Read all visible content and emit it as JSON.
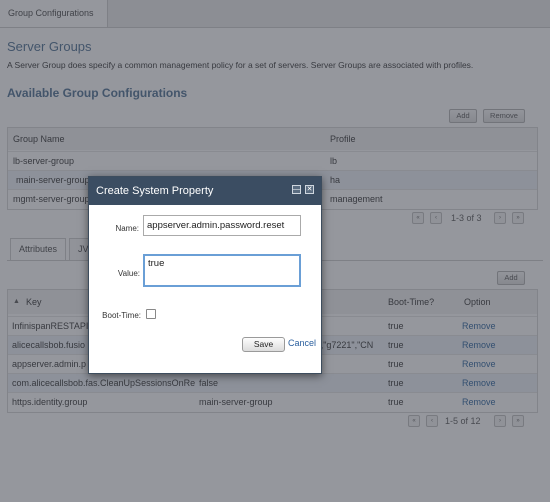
{
  "tabs": {
    "active": "Group Configurations"
  },
  "server_groups": {
    "title": "Server Groups",
    "description": "A Server Group does specify a common management policy for a set of servers. Server Groups are associated with profiles.",
    "available_title": "Available Group Configurations",
    "add_label": "Add",
    "remove_label": "Remove",
    "columns": [
      "Group Name",
      "Profile"
    ],
    "rows": [
      {
        "name": "lb-server-group",
        "profile": "lb"
      },
      {
        "name": "main-server-group",
        "profile": "ha"
      },
      {
        "name": "mgmt-server-group",
        "profile": "management"
      }
    ],
    "pager_text": "1-3 of 3"
  },
  "sub_tabs": [
    "Attributes",
    "JVM"
  ],
  "properties": {
    "add_label": "Add",
    "columns": {
      "key": "Key",
      "boot_time": "Boot-Time?",
      "option": "Option"
    },
    "rows": [
      {
        "key": "InfinispanRESTAPI",
        "value": "",
        "boot": "true",
        "option": "Remove"
      },
      {
        "key": "alicecallsbob.fusio",
        "value": "c\",\"g7221\",\"CN",
        "boot": "true",
        "option": "Remove"
      },
      {
        "key": "appserver.admin.p",
        "value": "",
        "boot": "true",
        "option": "Remove"
      },
      {
        "key": "com.alicecallsbob.fas.CleanUpSessionsOnRe",
        "value": "false",
        "boot": "true",
        "option": "Remove"
      },
      {
        "key": "https.identity.group",
        "value": "main-server-group",
        "boot": "true",
        "option": "Remove"
      }
    ],
    "pager_text": "1-5 of 12"
  },
  "dialog": {
    "title": "Create System Property",
    "name_label": "Name:",
    "name_value": "appserver.admin.password.reset",
    "value_label": "Value:",
    "value_value": "true",
    "boot_label": "Boot-Time:",
    "boot_checked": false,
    "save_label": "Save",
    "cancel_label": "Cancel"
  },
  "icons": {
    "maximize": "maximize-icon",
    "close": "close-icon",
    "sort": "sort-asc-icon",
    "pager_first": "first-page-icon",
    "pager_prev": "prev-page-icon",
    "pager_next": "next-page-icon",
    "pager_last": "last-page-icon"
  },
  "colors": {
    "dialog_header": "#3b4d62",
    "heading": "#5b7a9a",
    "link": "#3a6ea5"
  }
}
